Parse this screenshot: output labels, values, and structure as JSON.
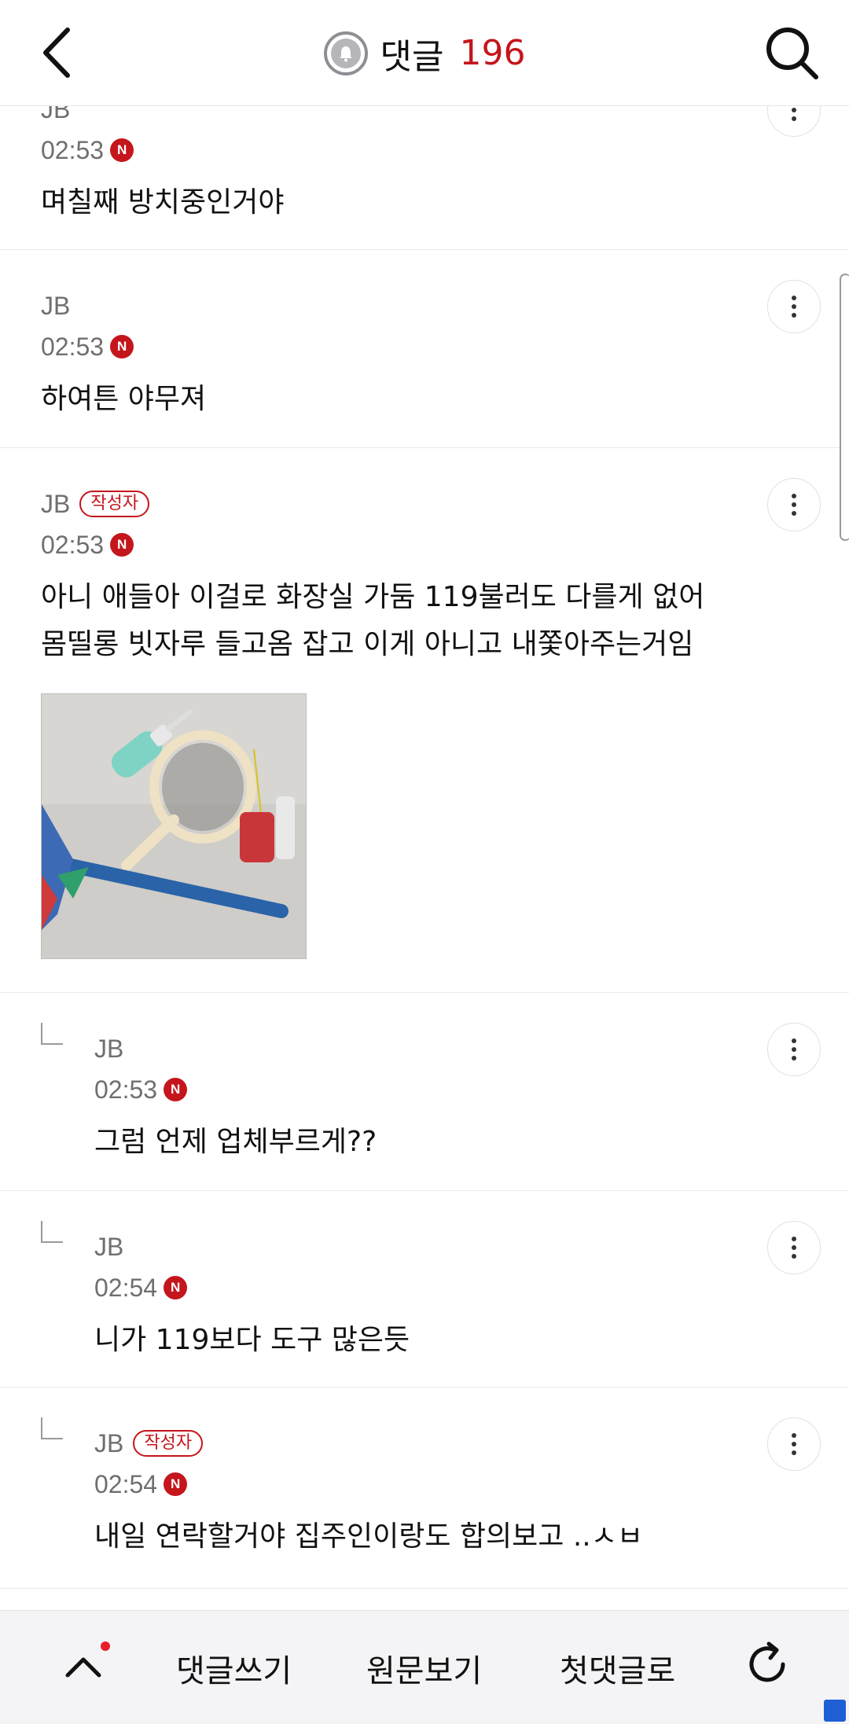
{
  "header": {
    "title": "댓글",
    "count": "196"
  },
  "comments": [
    {
      "author": "JB",
      "badge": "",
      "time": "02:53",
      "new_mark": "N",
      "text_lines": [
        "며칠째 방치중인거야"
      ]
    },
    {
      "author": "JB",
      "badge": "",
      "time": "02:53",
      "new_mark": "N",
      "text_lines": [
        "하여튼 야무져"
      ]
    },
    {
      "author": "JB",
      "badge": "작성자",
      "time": "02:53",
      "new_mark": "N",
      "text_lines": [
        "아니 애들아 이걸로 화장실 가둠 119불러도 다를게 없어",
        "몸띨롱 빗자루 들고옴 잡고 이게 아니고 내쫓아주는거임"
      ]
    },
    {
      "author": "JB",
      "badge": "",
      "time": "02:53",
      "new_mark": "N",
      "text_lines": [
        "그럼 언제 업체부르게??"
      ]
    },
    {
      "author": "JB",
      "badge": "",
      "time": "02:54",
      "new_mark": "N",
      "text_lines": [
        "니가 119보다 도구 많은듯"
      ]
    },
    {
      "author": "JB",
      "badge": "작성자",
      "time": "02:54",
      "new_mark": "N",
      "text_lines": [
        "내일 연락할거야 집주인이랑도 합의보고 ..ㅅㅂ"
      ]
    }
  ],
  "bottom_bar": {
    "write": "댓글쓰기",
    "view_original": "원문보기",
    "first_comment": "첫댓글로"
  },
  "colors": {
    "accent": "#c4161c",
    "meta_text": "#6f6f6f",
    "divider": "#e9e9e9"
  }
}
